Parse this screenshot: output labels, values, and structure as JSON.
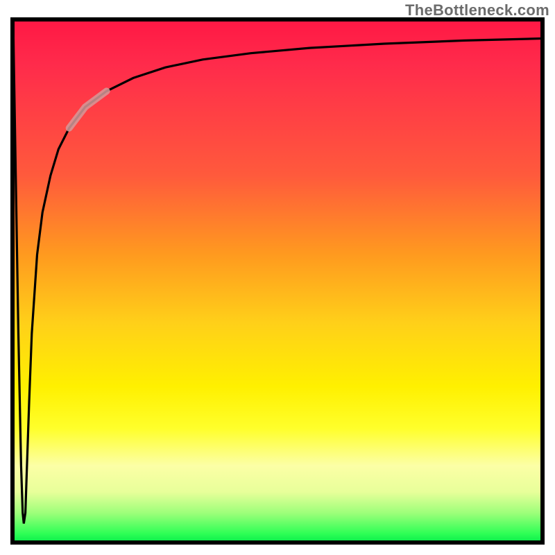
{
  "watermark": "TheBottleneck.com",
  "chart_data": {
    "type": "line",
    "title": "",
    "xlabel": "",
    "ylabel": "",
    "xlim": [
      0,
      100
    ],
    "ylim": [
      0,
      100
    ],
    "grid": false,
    "legend": false,
    "annotations": [
      {
        "text": "TheBottleneck.com",
        "position": "top-right"
      }
    ],
    "series": [
      {
        "name": "curve",
        "x": [
          0.5,
          1.0,
          1.5,
          2.0,
          2.3,
          2.5,
          2.8,
          3.0,
          3.5,
          4.0,
          5.0,
          6.0,
          7.5,
          9.0,
          11.0,
          14.0,
          18.0,
          23.0,
          29.0,
          36.0,
          45.0,
          56.0,
          70.0,
          85.0,
          100.0
        ],
        "y": [
          100.0,
          70.0,
          40.0,
          15.0,
          6.0,
          4.0,
          6.0,
          12.0,
          27.0,
          40.0,
          55.0,
          63.0,
          70.0,
          75.0,
          79.0,
          83.0,
          86.0,
          88.5,
          90.5,
          92.0,
          93.2,
          94.2,
          95.0,
          95.6,
          96.0
        ]
      }
    ],
    "highlight_segment": {
      "x_start": 11.0,
      "x_end": 18.0
    },
    "background_gradient_stops": [
      {
        "pos": 0.0,
        "color": "#ff1744"
      },
      {
        "pos": 0.3,
        "color": "#ff5a3c"
      },
      {
        "pos": 0.58,
        "color": "#ffd019"
      },
      {
        "pos": 0.78,
        "color": "#ffff2b"
      },
      {
        "pos": 0.94,
        "color": "#9dff7a"
      },
      {
        "pos": 1.0,
        "color": "#00e648"
      }
    ]
  }
}
